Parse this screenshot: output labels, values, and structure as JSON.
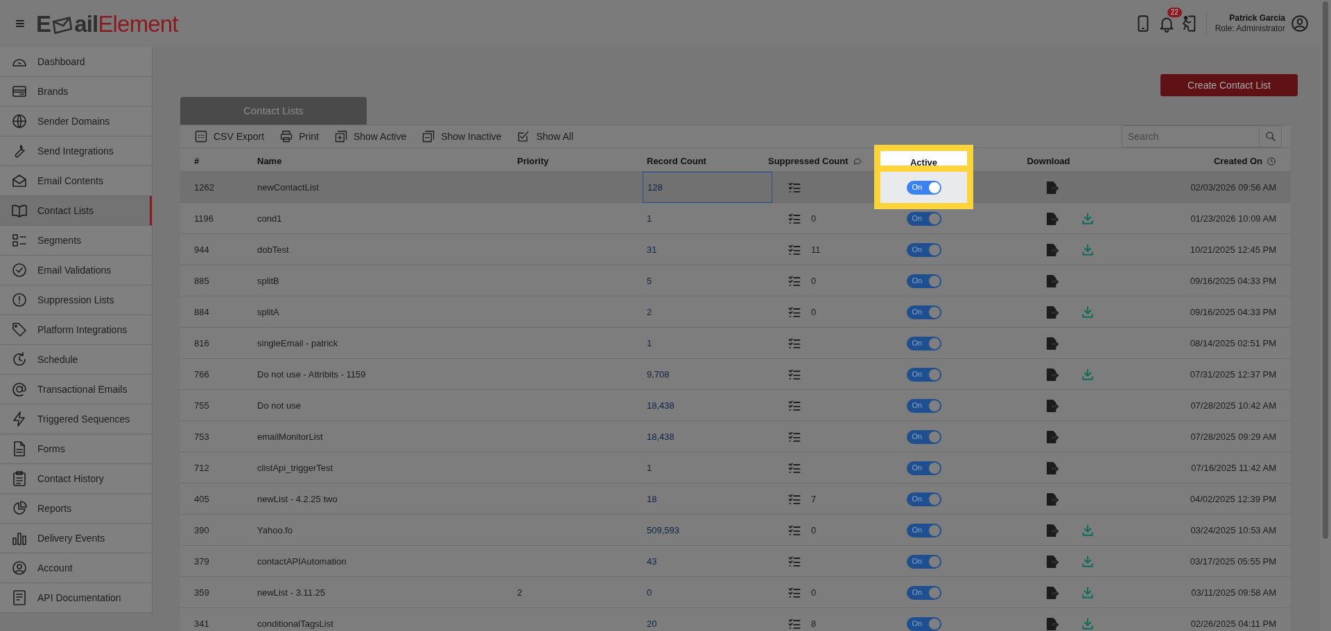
{
  "header": {
    "menu_glyph": "≡",
    "logo_parts": [
      "E",
      "ail",
      "Element"
    ],
    "notification_count": "22",
    "user_name": "Patrick Garcia",
    "user_role": "Role: Administrator"
  },
  "sidebar": {
    "items": [
      {
        "label": "Dashboard",
        "selected": false
      },
      {
        "label": "Brands",
        "selected": false
      },
      {
        "label": "Sender Domains",
        "selected": false
      },
      {
        "label": "Send Integrations",
        "selected": false
      },
      {
        "label": "Email Contents",
        "selected": false
      },
      {
        "label": "Contact Lists",
        "selected": true
      },
      {
        "label": "Segments",
        "selected": false
      },
      {
        "label": "Email Validations",
        "selected": false
      },
      {
        "label": "Suppression Lists",
        "selected": false
      },
      {
        "label": "Platform Integrations",
        "selected": false
      },
      {
        "label": "Schedule",
        "selected": false
      },
      {
        "label": "Transactional Emails",
        "selected": false
      },
      {
        "label": "Triggered Sequences",
        "selected": false
      },
      {
        "label": "Forms",
        "selected": false
      },
      {
        "label": "Contact History",
        "selected": false
      },
      {
        "label": "Reports",
        "selected": false
      },
      {
        "label": "Delivery Events",
        "selected": false
      },
      {
        "label": "Account",
        "selected": false
      },
      {
        "label": "API Documentation",
        "selected": false
      }
    ]
  },
  "create_button": "Create Contact List",
  "panel_tab": "Contact Lists",
  "toolbar": [
    "CSV Export",
    "Print",
    "Show Active",
    "Show Inactive",
    "Show All"
  ],
  "search": {
    "placeholder": "Search"
  },
  "table": {
    "columns": [
      "#",
      "Name",
      "Priority",
      "Record Count",
      "Suppressed Count",
      "Active",
      "Download",
      "Created On"
    ],
    "rows": [
      {
        "id": "1262",
        "name": "newContactList",
        "priority": "",
        "record_count": "128",
        "suppressed": "",
        "on": true,
        "toggle_label": "On",
        "has_download": false,
        "created": "02/03/2026 09:56 AM",
        "selected": true,
        "highlighted": true
      },
      {
        "id": "1196",
        "name": "cond1",
        "priority": "",
        "record_count": "1",
        "suppressed": "0",
        "on": true,
        "toggle_label": "On",
        "has_download": true,
        "created": "01/23/2026 10:09 AM",
        "selected": false,
        "highlighted": false
      },
      {
        "id": "944",
        "name": "dobTest",
        "priority": "",
        "record_count": "31",
        "suppressed": "11",
        "on": true,
        "toggle_label": "On",
        "has_download": true,
        "created": "10/21/2025 12:45 PM",
        "selected": false,
        "highlighted": false
      },
      {
        "id": "885",
        "name": "splitB",
        "priority": "",
        "record_count": "5",
        "suppressed": "0",
        "on": true,
        "toggle_label": "On",
        "has_download": false,
        "created": "09/16/2025 04:33 PM",
        "selected": false,
        "highlighted": false
      },
      {
        "id": "884",
        "name": "splitA",
        "priority": "",
        "record_count": "2",
        "suppressed": "0",
        "on": true,
        "toggle_label": "On",
        "has_download": true,
        "created": "09/16/2025 04:33 PM",
        "selected": false,
        "highlighted": false
      },
      {
        "id": "816",
        "name": "singleEmail - patrick",
        "priority": "",
        "record_count": "1",
        "suppressed": "",
        "on": true,
        "toggle_label": "On",
        "has_download": false,
        "created": "08/14/2025 02:51 PM",
        "selected": false,
        "highlighted": false
      },
      {
        "id": "766",
        "name": "Do not use - Attribits - 1159",
        "priority": "",
        "record_count": "9,708",
        "suppressed": "",
        "on": true,
        "toggle_label": "On",
        "has_download": true,
        "created": "07/31/2025 12:37 PM",
        "selected": false,
        "highlighted": false
      },
      {
        "id": "755",
        "name": "Do not use",
        "priority": "",
        "record_count": "18,438",
        "suppressed": "",
        "on": true,
        "toggle_label": "On",
        "has_download": false,
        "created": "07/28/2025 10:42 AM",
        "selected": false,
        "highlighted": false
      },
      {
        "id": "753",
        "name": "emailMonitorList",
        "priority": "",
        "record_count": "18,438",
        "suppressed": "",
        "on": true,
        "toggle_label": "On",
        "has_download": false,
        "created": "07/28/2025 09:29 AM",
        "selected": false,
        "highlighted": false
      },
      {
        "id": "712",
        "name": "clistApi_triggerTest",
        "priority": "",
        "record_count": "1",
        "suppressed": "",
        "on": true,
        "toggle_label": "On",
        "has_download": false,
        "created": "07/16/2025 11:42 AM",
        "selected": false,
        "highlighted": false
      },
      {
        "id": "405",
        "name": "newList - 4.2.25 two",
        "priority": "",
        "record_count": "18",
        "suppressed": "7",
        "on": true,
        "toggle_label": "On",
        "has_download": false,
        "created": "04/02/2025 12:39 PM",
        "selected": false,
        "highlighted": false
      },
      {
        "id": "390",
        "name": "Yahoo.fo",
        "priority": "",
        "record_count": "509,593",
        "suppressed": "0",
        "on": true,
        "toggle_label": "On",
        "has_download": true,
        "created": "03/24/2025 10:53 AM",
        "selected": false,
        "highlighted": false
      },
      {
        "id": "379",
        "name": "contactAPIAutomation",
        "priority": "",
        "record_count": "43",
        "suppressed": "",
        "on": true,
        "toggle_label": "On",
        "has_download": true,
        "created": "03/17/2025 05:55 PM",
        "selected": false,
        "highlighted": false
      },
      {
        "id": "359",
        "name": "newList - 3.11.25",
        "priority": "2",
        "record_count": "0",
        "suppressed": "0",
        "on": true,
        "toggle_label": "On",
        "has_download": true,
        "created": "03/11/2025 09:58 AM",
        "selected": false,
        "highlighted": false
      },
      {
        "id": "341",
        "name": "conditionalTagsList",
        "priority": "",
        "record_count": "20",
        "suppressed": "8",
        "on": true,
        "toggle_label": "On",
        "has_download": true,
        "created": "02/26/2025 04:11 PM",
        "selected": false,
        "highlighted": false
      }
    ]
  }
}
